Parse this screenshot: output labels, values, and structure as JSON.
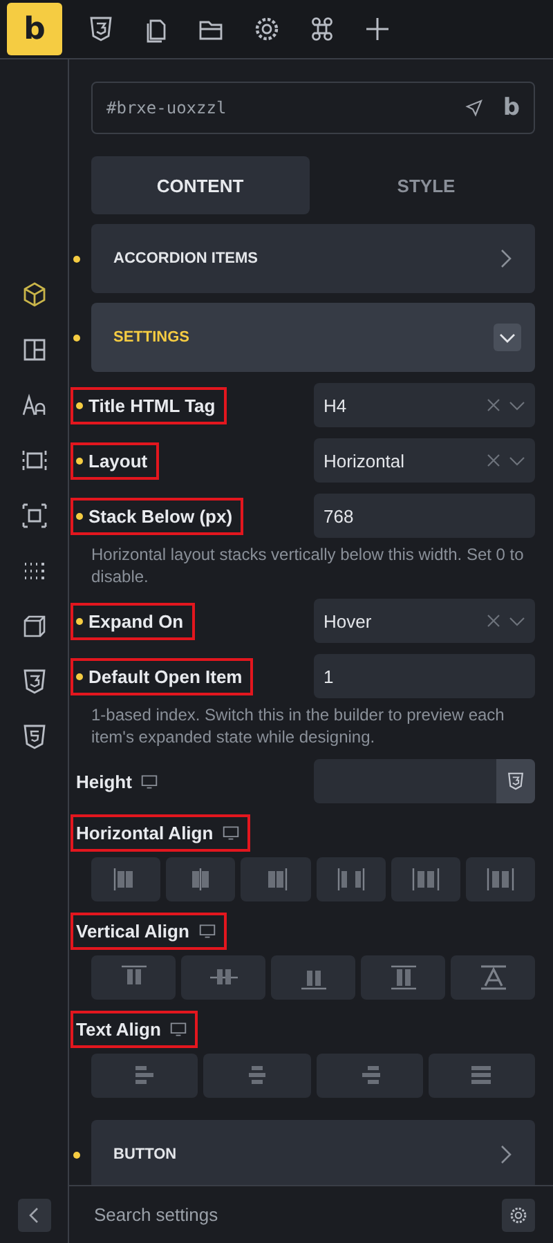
{
  "toolbar": {
    "logo": "b"
  },
  "sidebar": {
    "items": [
      {
        "selected": true
      },
      {
        "selected": false
      },
      {
        "selected": false
      },
      {
        "selected": false
      },
      {
        "selected": false
      },
      {
        "selected": false
      },
      {
        "selected": false
      },
      {
        "selected": false
      },
      {
        "selected": false
      }
    ]
  },
  "element_id": {
    "value": "#brxe-uoxzzl",
    "logo": "b"
  },
  "tabs": [
    {
      "label": "CONTENT",
      "selected": true
    },
    {
      "label": "STYLE",
      "selected": false
    }
  ],
  "groups_top": [
    {
      "title": "ACCORDION ITEMS",
      "expanded": false,
      "modified": true
    },
    {
      "title": "SETTINGS",
      "expanded": true,
      "modified": true
    }
  ],
  "controls": [
    {
      "kind": "select",
      "label": "Title HTML Tag",
      "value": "H4",
      "modified": true,
      "highlighted": true,
      "responsive": false
    },
    {
      "kind": "select",
      "label": "Layout",
      "value": "Horizontal",
      "modified": true,
      "highlighted": true,
      "responsive": false
    },
    {
      "kind": "input",
      "label": "Stack Below (px)",
      "value": "768",
      "modified": true,
      "highlighted": true,
      "responsive": false,
      "help": "Horizontal layout stacks vertically below this width. Set 0 to disable."
    },
    {
      "kind": "select",
      "label": "Expand On",
      "value": "Hover",
      "modified": true,
      "highlighted": true,
      "responsive": false
    },
    {
      "kind": "input",
      "label": "Default Open Item",
      "value": "1",
      "modified": true,
      "highlighted": true,
      "responsive": false,
      "help": "1-based index. Switch this in the builder to preview each item's expanded state while designing."
    },
    {
      "kind": "css-input",
      "label": "Height",
      "modified": false,
      "highlighted": false,
      "responsive": true
    },
    {
      "kind": "buttons",
      "label": "Horizontal Align",
      "modified": false,
      "highlighted": true,
      "responsive": true,
      "options": [
        {
          "selected": false
        },
        {
          "selected": false
        },
        {
          "selected": false
        },
        {
          "selected": false
        },
        {
          "selected": false
        },
        {
          "selected": false
        }
      ]
    },
    {
      "kind": "buttons",
      "label": "Vertical Align",
      "modified": false,
      "highlighted": true,
      "responsive": true,
      "options": [
        {
          "selected": false
        },
        {
          "selected": false
        },
        {
          "selected": false
        },
        {
          "selected": false
        },
        {
          "selected": false
        }
      ]
    },
    {
      "kind": "buttons",
      "label": "Text Align",
      "modified": false,
      "highlighted": true,
      "responsive": true,
      "options": [
        {
          "selected": false
        },
        {
          "selected": false
        },
        {
          "selected": false
        },
        {
          "selected": false
        }
      ]
    }
  ],
  "groups_bottom": [
    {
      "title": "BUTTON",
      "expanded": false,
      "modified": true
    }
  ],
  "search": {
    "placeholder": "Search settings"
  }
}
